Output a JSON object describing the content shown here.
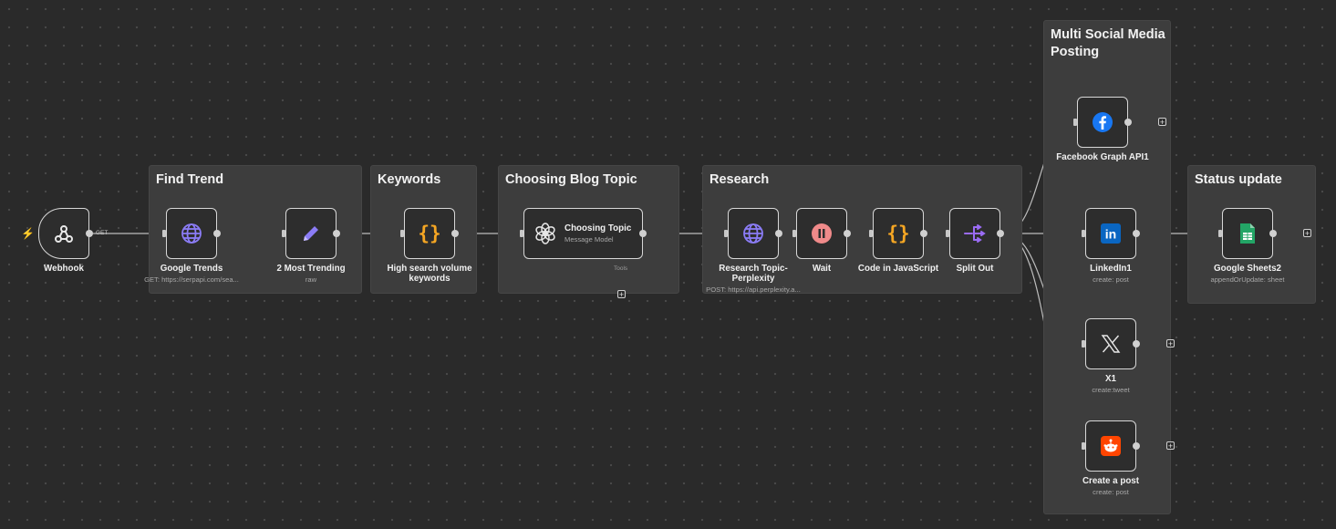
{
  "groups": [
    {
      "id": "find-trend",
      "title": "Find Trend"
    },
    {
      "id": "keywords",
      "title": "Keywords"
    },
    {
      "id": "choosing-blog-topic",
      "title": "Choosing Blog Topic"
    },
    {
      "id": "research",
      "title": "Research"
    },
    {
      "id": "multi-social",
      "title": "Multi Social Media Posting"
    },
    {
      "id": "status-update",
      "title": "Status update"
    }
  ],
  "nodes": {
    "webhook": {
      "label": "Webhook",
      "edge_label": "GET",
      "icon": "webhook-icon"
    },
    "google_trends": {
      "label": "Google Trends",
      "sub": "GET: https://serpapi.com/sea...",
      "icon": "globe-icon"
    },
    "most_trending": {
      "label": "2 Most Trending",
      "sub": "raw",
      "icon": "pencil-icon"
    },
    "keywords": {
      "label": "High search volume keywords",
      "icon": "code-braces-icon"
    },
    "choosing_topic": {
      "label": "Choosing Topic",
      "sub": "Message Model",
      "tools": "Tools",
      "icon": "openai-icon"
    },
    "research_topic": {
      "label": "Research Topic- Perplexity",
      "sub": "POST: https://api.perplexity.a...",
      "icon": "globe-icon"
    },
    "wait": {
      "label": "Wait",
      "icon": "pause-icon"
    },
    "code_js": {
      "label": "Code in JavaScript",
      "icon": "code-braces-icon"
    },
    "split_out": {
      "label": "Split Out",
      "icon": "split-icon"
    },
    "facebook": {
      "label": "Facebook Graph API1",
      "icon": "facebook-icon"
    },
    "linkedin": {
      "label": "LinkedIn1",
      "sub": "create: post",
      "icon": "linkedin-icon"
    },
    "x": {
      "label": "X1",
      "sub": "create:tweet",
      "icon": "x-icon"
    },
    "reddit": {
      "label": "Create a post",
      "sub": "create: post",
      "icon": "reddit-icon"
    },
    "sheets": {
      "label": "Google Sheets2",
      "sub": "appendOrUpdate: sheet",
      "icon": "google-sheets-icon"
    }
  },
  "colors": {
    "canvas": "#2a2a2a",
    "group": "#3d3d3d",
    "wire": "#bdbdbd",
    "globe": "#8b7cf6",
    "pencil": "#8b7cf6",
    "braces": "#f5a623",
    "wait": "#f08a8a",
    "split": "#9b6cf5",
    "facebook": "#1877f2",
    "linkedin": "#0a66c2",
    "reddit": "#ff4500",
    "sheets": "#23a566",
    "trigger": "#e8524a"
  }
}
